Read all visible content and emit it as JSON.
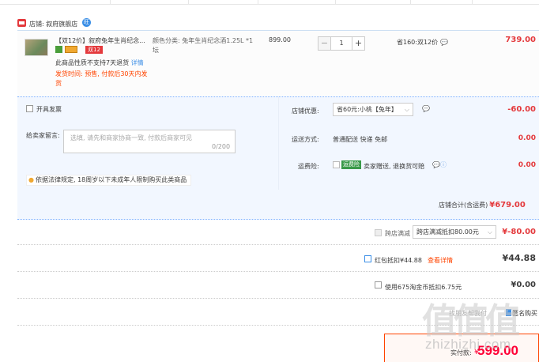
{
  "shop": {
    "name": "店铺: 叙府旗舰店",
    "wangwang": "旺"
  },
  "item": {
    "title": "【双12价】叙府兔年生肖纪念...",
    "badge_d12": "双12",
    "no_return": "此商品性质不支持7天退货",
    "no_return_link": "详情",
    "ship_time": "发货时间: 预售, 付款后30天内发货",
    "spec": "颜色分类: 兔年生肖纪念酒1.25L *1坛",
    "price": "899.00",
    "quantity": "1",
    "qty_minus": "−",
    "qty_plus": "+",
    "save_note": "省160:双12价",
    "subtotal": "739.00"
  },
  "options": {
    "invoice_label": "开具发票",
    "message_label": "给卖家留言:",
    "message_placeholder": "选填, 请先和商家协商一致, 付款后商家可见",
    "message_count": "0/200",
    "law_notice": "依据法律规定, 18周岁以下未成年人限制购买此类商品",
    "coupon_label": "店铺优惠:",
    "coupon_selected": "省60元:小桃【兔年】",
    "coupon_value": "-60.00",
    "shipping_label": "运送方式:",
    "shipping_value": "普通配送 快递 免邮",
    "shipping_amount": "0.00",
    "insurance_label": "运费险:",
    "insurance_tag": "运费险",
    "insurance_text": "卖家赠送, 退换货可赔",
    "insurance_amount": "0.00"
  },
  "shop_total": {
    "label": "店铺合计(含运费)",
    "amount": "¥679.00"
  },
  "discounts": {
    "cross_label": "跨店满减",
    "cross_selected": "跨店满减抵扣80.00元",
    "cross_value": "¥-80.00",
    "redpack_label": "红包抵扣¥44.88",
    "redpack_link": "查看详情",
    "redpack_value": "¥44.88",
    "coin_label": "使用675淘金币抵扣6.75元",
    "coin_value": "¥0.00",
    "friend_pay": "找朋友帮我付",
    "anon_label": "匿名购买"
  },
  "final": {
    "label": "实付款:",
    "currency": "¥",
    "amount": "599.00"
  },
  "watermark": {
    "big": "值值值",
    "url": "zhizhizhi.com"
  }
}
